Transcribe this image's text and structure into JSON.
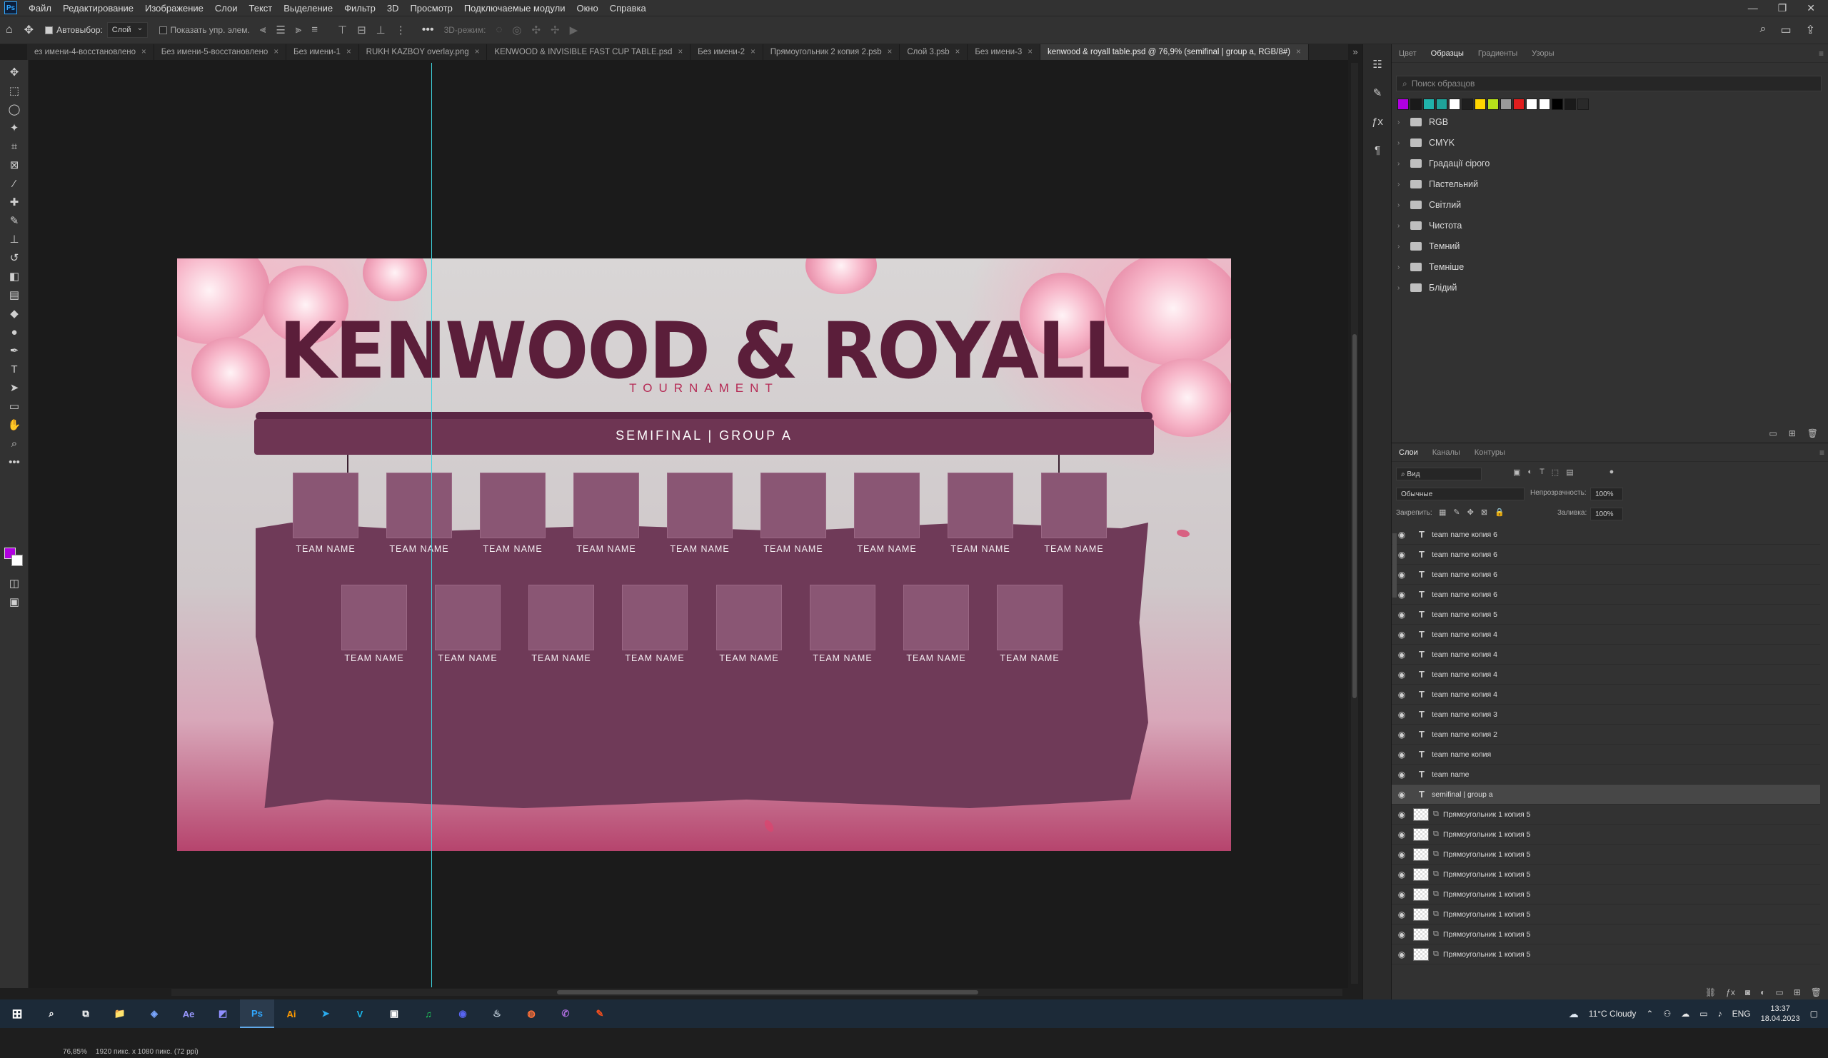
{
  "menu": [
    "Файл",
    "Редактирование",
    "Изображение",
    "Слои",
    "Текст",
    "Выделение",
    "Фильтр",
    "3D",
    "Просмотр",
    "Подключаемые модули",
    "Окно",
    "Справка"
  ],
  "options": {
    "autoselect": "Автовыбор:",
    "layer_mode": "Слой",
    "show_controls": "Показать упр. элем.",
    "mode_3d": "3D-режим:"
  },
  "tabs": [
    "ез имени-4-восстановлено",
    "Без имени-5-восстановлено",
    "Без имени-1",
    "RUKH KAZBOY overlay.png",
    "KENWOOD & INVISIBLE FAST CUP TABLE.psd",
    "Без имени-2",
    "Прямоугольник 2 копия 2.psb",
    "Слой 3.psb",
    "Без имени-3",
    "kenwood & royall table.psd @ 76,9% (semifinal | group a, RGB/8#)"
  ],
  "artwork": {
    "title": "KENWOOD & ROYALL",
    "subtitle": "TOURNAMENT",
    "banner": "SEMIFINAL | GROUP A",
    "team_label": "TEAM NAME"
  },
  "status": {
    "zoom": "76,85%",
    "doc_size": "1920 пикс. x 1080 пикс. (72 ppi)"
  },
  "swatches": {
    "tabs": [
      "Цвет",
      "Образцы",
      "Градиенты",
      "Узоры"
    ],
    "search_placeholder": "Поиск образцов",
    "colors": [
      "#b000e0",
      "#1a1a1a",
      "#20b2aa",
      "#1fa39a",
      "#ffffff",
      "#1f1f1f",
      "#ffd500",
      "#b6e21a",
      "#9a9a9a",
      "#e01e1e",
      "#ffffff",
      "#ffffff",
      "#000000",
      "#1a1a1a",
      "#2a2a2a"
    ],
    "folders": [
      "RGB",
      "CMYK",
      "Градації сірого",
      "Пастельний",
      "Світлий",
      "Чистота",
      "Темний",
      "Темніше",
      "Блідий"
    ]
  },
  "layers": {
    "tabs": [
      "Слои",
      "Каналы",
      "Контуры"
    ],
    "filter": "Вид",
    "blend": "Обычные",
    "opacity_label": "Непрозрачность:",
    "opacity": "100%",
    "lock_label": "Закрепить:",
    "fill_label": "Заливка:",
    "fill": "100%",
    "items": [
      {
        "name": "team name копия 6",
        "type": "text"
      },
      {
        "name": "team name копия 6",
        "type": "text"
      },
      {
        "name": "team name копия 6",
        "type": "text"
      },
      {
        "name": "team name копия 6",
        "type": "text"
      },
      {
        "name": "team name копия 5",
        "type": "text"
      },
      {
        "name": "team name копия 4",
        "type": "text"
      },
      {
        "name": "team name копия 4",
        "type": "text"
      },
      {
        "name": "team name копия 4",
        "type": "text"
      },
      {
        "name": "team name копия 4",
        "type": "text"
      },
      {
        "name": "team name копия 3",
        "type": "text"
      },
      {
        "name": "team name копия 2",
        "type": "text"
      },
      {
        "name": "team name копия",
        "type": "text"
      },
      {
        "name": "team name",
        "type": "text"
      },
      {
        "name": "semifinal | group a",
        "type": "text",
        "selected": true
      },
      {
        "name": "Прямоугольник 1 копия 5",
        "type": "shape"
      },
      {
        "name": "Прямоугольник 1 копия 5",
        "type": "shape"
      },
      {
        "name": "Прямоугольник 1 копия 5",
        "type": "shape"
      },
      {
        "name": "Прямоугольник 1 копия 5",
        "type": "shape"
      },
      {
        "name": "Прямоугольник 1 копия 5",
        "type": "shape"
      },
      {
        "name": "Прямоугольник 1 копия 5",
        "type": "shape"
      },
      {
        "name": "Прямоугольник 1 копия 5",
        "type": "shape"
      },
      {
        "name": "Прямоугольник 1 копия 5",
        "type": "shape"
      }
    ]
  },
  "taskbar": {
    "apps": [
      {
        "label": "📁",
        "color": "#f2c14e"
      },
      {
        "label": "◈",
        "color": "#7aa7ff"
      },
      {
        "label": "Ae",
        "color": "#9999ff"
      },
      {
        "label": "◩",
        "color": "#8f8fff"
      },
      {
        "label": "Ps",
        "color": "#31a8ff",
        "active": true
      },
      {
        "label": "Ai",
        "color": "#ff9a00"
      },
      {
        "label": "➤",
        "color": "#2aabee"
      },
      {
        "label": "V",
        "color": "#1ab7ea"
      },
      {
        "label": "▣",
        "color": "#ffffff"
      },
      {
        "label": "♫",
        "color": "#1ed760"
      },
      {
        "label": "◉",
        "color": "#5865f2"
      },
      {
        "label": "♨",
        "color": "#c7d5e0"
      },
      {
        "label": "◍",
        "color": "#ff7139"
      },
      {
        "label": "✆",
        "color": "#a96bd8"
      },
      {
        "label": "✎",
        "color": "#f24e1e"
      }
    ],
    "weather": "11°C  Cloudy",
    "lang": "ENG",
    "time": "13:37",
    "date": "18.04.2023"
  }
}
